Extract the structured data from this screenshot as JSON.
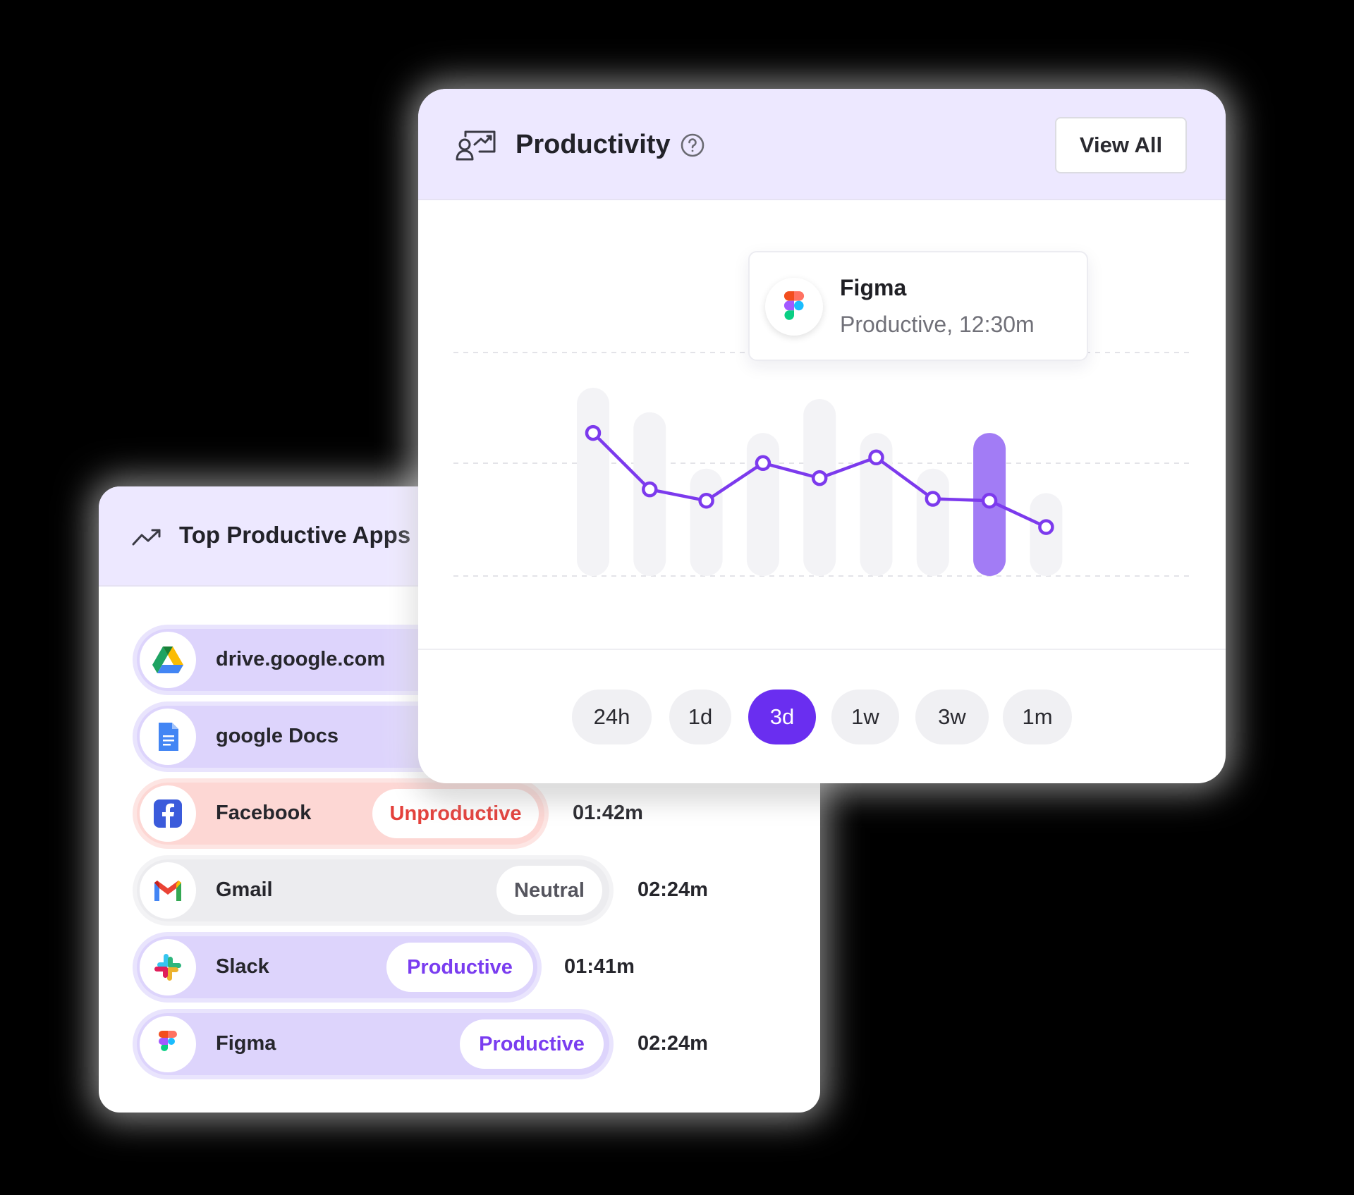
{
  "top_apps": {
    "title": "Top Productive Apps",
    "icon": "trending-up-icon",
    "apps": [
      {
        "name": "drive.google.com",
        "icon": "google-drive-icon",
        "status": "",
        "duration": "",
        "tone": "productive"
      },
      {
        "name": "google Docs",
        "icon": "google-docs-icon",
        "status": "",
        "duration": "",
        "tone": "productive"
      },
      {
        "name": "Facebook",
        "icon": "facebook-icon",
        "status": "Unproductive",
        "duration": "01:42m",
        "tone": "unproductive"
      },
      {
        "name": "Gmail",
        "icon": "gmail-icon",
        "status": "Neutral",
        "duration": "02:24m",
        "tone": "neutral"
      },
      {
        "name": "Slack",
        "icon": "slack-icon",
        "status": "Productive",
        "duration": "01:41m",
        "tone": "productive"
      },
      {
        "name": "Figma",
        "icon": "figma-icon",
        "status": "Productive",
        "duration": "02:24m",
        "tone": "productive"
      }
    ]
  },
  "productivity": {
    "title": "Productivity",
    "header_icon": "monitor-chart-icon",
    "help_icon": "question-circle-icon",
    "view_all_label": "View All",
    "tooltip": {
      "icon": "figma-icon",
      "title": "Figma",
      "subtitle": "Productive, 12:30m"
    },
    "time_ranges": [
      "24h",
      "1d",
      "3d",
      "1w",
      "3w",
      "1m"
    ],
    "active_range": "3d"
  },
  "colors": {
    "accent": "#6a2ef0",
    "line": "#7c3aed",
    "bar_highlight": "#a27cf5",
    "bar": "#f3f3f6",
    "header_bg": "#ede8ff",
    "unproductive": "#e4403b",
    "productive_pill": "#ddd4fc",
    "unproductive_pill": "#fdd7d4",
    "neutral_pill": "#ececef"
  },
  "chart_data": {
    "type": "bar",
    "highlight_index": 7,
    "bars": [
      1.0,
      0.87,
      0.57,
      0.76,
      0.94,
      0.76,
      0.57,
      0.76,
      0.44
    ],
    "line": [
      0.76,
      0.46,
      0.4,
      0.6,
      0.52,
      0.63,
      0.41,
      0.4,
      0.26
    ],
    "ylim": [
      0,
      1
    ],
    "grid": true
  }
}
